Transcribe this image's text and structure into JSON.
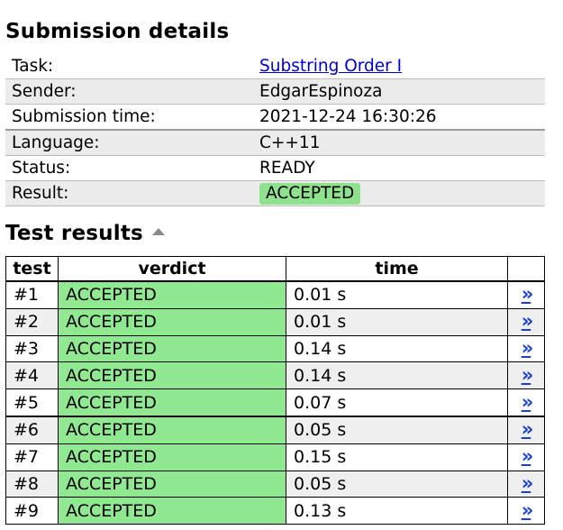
{
  "submission": {
    "title": "Submission details",
    "rows": [
      {
        "label": "Task:",
        "value": "Substring Order I"
      },
      {
        "label": "Sender:",
        "value": "EdgarEspinoza"
      },
      {
        "label": "Submission time:",
        "value": "2021-12-24 16:30:26"
      },
      {
        "label": "Language:",
        "value": "C++11"
      },
      {
        "label": "Status:",
        "value": "READY"
      },
      {
        "label": "Result:",
        "value": "ACCEPTED"
      }
    ],
    "colors": {
      "accepted": "#8ee28e",
      "link": "#0000cc"
    }
  },
  "tests": {
    "title": "Test results",
    "sort_icon": "triangle-up-icon",
    "headers": {
      "test": "test",
      "verdict": "verdict",
      "time": "time"
    },
    "link_glyph": "»",
    "rows": [
      {
        "test": "#1",
        "verdict": "ACCEPTED",
        "time": "0.01 s"
      },
      {
        "test": "#2",
        "verdict": "ACCEPTED",
        "time": "0.01 s"
      },
      {
        "test": "#3",
        "verdict": "ACCEPTED",
        "time": "0.14 s"
      },
      {
        "test": "#4",
        "verdict": "ACCEPTED",
        "time": "0.14 s"
      },
      {
        "test": "#5",
        "verdict": "ACCEPTED",
        "time": "0.07 s"
      },
      {
        "test": "#6",
        "verdict": "ACCEPTED",
        "time": "0.05 s"
      },
      {
        "test": "#7",
        "verdict": "ACCEPTED",
        "time": "0.15 s"
      },
      {
        "test": "#8",
        "verdict": "ACCEPTED",
        "time": "0.05 s"
      },
      {
        "test": "#9",
        "verdict": "ACCEPTED",
        "time": "0.13 s"
      }
    ]
  }
}
